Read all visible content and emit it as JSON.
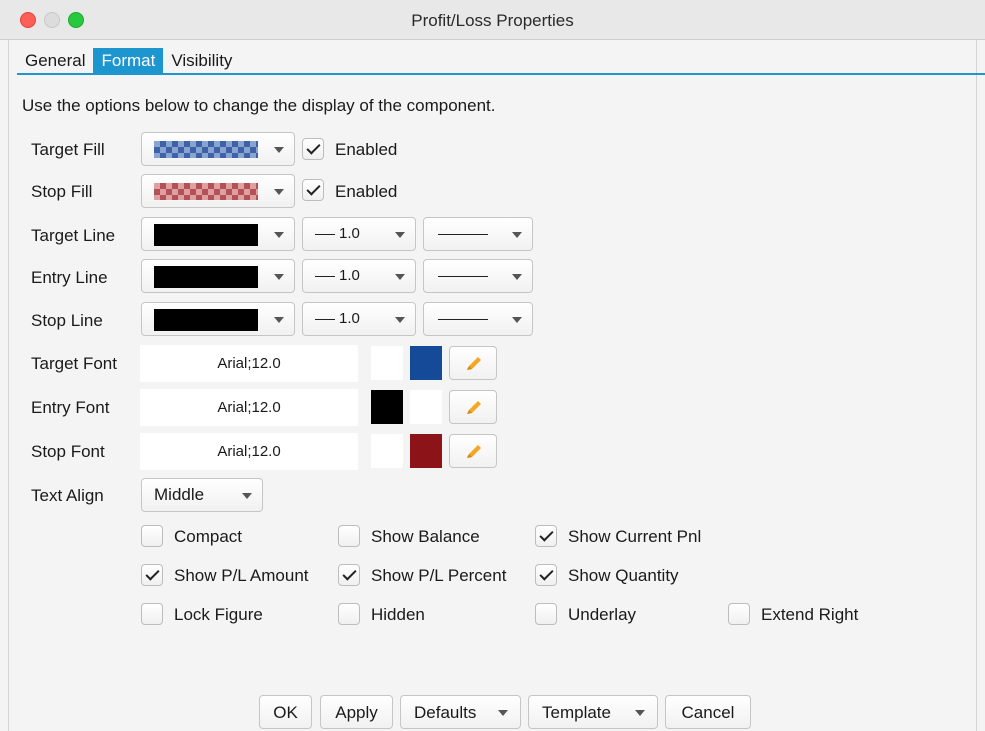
{
  "window": {
    "title": "Profit/Loss Properties"
  },
  "tabs": [
    {
      "label": "General",
      "active": false
    },
    {
      "label": "Format",
      "active": true
    },
    {
      "label": "Visibility",
      "active": false
    }
  ],
  "intro_text": "Use the options below to change the display of the component.",
  "rows": {
    "target_fill": {
      "label": "Target Fill",
      "enabled_label": "Enabled",
      "enabled": true,
      "color": "#3d62a8"
    },
    "stop_fill": {
      "label": "Stop Fill",
      "enabled_label": "Enabled",
      "enabled": true,
      "color": "#b25256"
    },
    "target_line": {
      "label": "Target Line",
      "color": "#000000",
      "width": "1.0"
    },
    "entry_line": {
      "label": "Entry Line",
      "color": "#000000",
      "width": "1.0"
    },
    "stop_line": {
      "label": "Stop Line",
      "color": "#000000",
      "width": "1.0"
    },
    "target_font": {
      "label": "Target Font",
      "value": "Arial;12.0",
      "bg_color": "#ffffff",
      "fg_color": "#154a99"
    },
    "entry_font": {
      "label": "Entry Font",
      "value": "Arial;12.0",
      "bg_color": "#000000",
      "fg_color": "#ffffff"
    },
    "stop_font": {
      "label": "Stop Font",
      "value": "Arial;12.0",
      "bg_color": "#ffffff",
      "fg_color": "#8c1419"
    },
    "text_align": {
      "label": "Text Align",
      "value": "Middle"
    }
  },
  "options": {
    "compact": {
      "label": "Compact",
      "checked": false
    },
    "show_balance": {
      "label": "Show Balance",
      "checked": false
    },
    "show_current_pnl": {
      "label": "Show Current Pnl",
      "checked": true
    },
    "show_pl_amount": {
      "label": "Show P/L Amount",
      "checked": true
    },
    "show_pl_percent": {
      "label": "Show P/L Percent",
      "checked": true
    },
    "show_quantity": {
      "label": "Show Quantity",
      "checked": true
    },
    "lock_figure": {
      "label": "Lock Figure",
      "checked": false
    },
    "hidden": {
      "label": "Hidden",
      "checked": false
    },
    "underlay": {
      "label": "Underlay",
      "checked": false
    },
    "extend_right": {
      "label": "Extend Right",
      "checked": false
    }
  },
  "buttons": {
    "ok": "OK",
    "apply": "Apply",
    "defaults": "Defaults",
    "template": "Template",
    "cancel": "Cancel"
  },
  "colors": {
    "accent": "#1d95cf",
    "pencil": "#f5a623"
  }
}
